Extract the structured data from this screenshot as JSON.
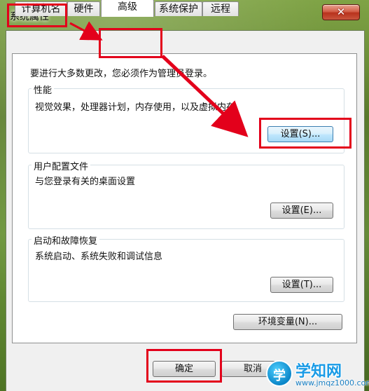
{
  "window": {
    "title": "系统属性",
    "close_glyph": "✕"
  },
  "tabs": [
    {
      "label": "计算机名"
    },
    {
      "label": "硬件"
    },
    {
      "label": "高级",
      "active": true
    },
    {
      "label": "系统保护"
    },
    {
      "label": "远程"
    }
  ],
  "notice": "要进行大多数更改，您必须作为管理员登录。",
  "groups": {
    "performance": {
      "label": "性能",
      "description": "视觉效果，处理器计划，内存使用，以及虚拟内存",
      "button": "设置(S)..."
    },
    "user_profiles": {
      "label": "用户配置文件",
      "description": "与您登录有关的桌面设置",
      "button": "设置(E)..."
    },
    "startup_recovery": {
      "label": "启动和故障恢复",
      "description": "系统启动、系统失败和调试信息",
      "button": "设置(T)..."
    }
  },
  "env_button": "环境变量(N)...",
  "footer": {
    "ok": "确定",
    "cancel": "取消"
  },
  "watermark": {
    "logo_char": "学",
    "title": "学知网",
    "url": "www.jmqz1000.com"
  },
  "colors": {
    "annotation": "#e3001b",
    "window_frame": "#6b8f3a"
  }
}
